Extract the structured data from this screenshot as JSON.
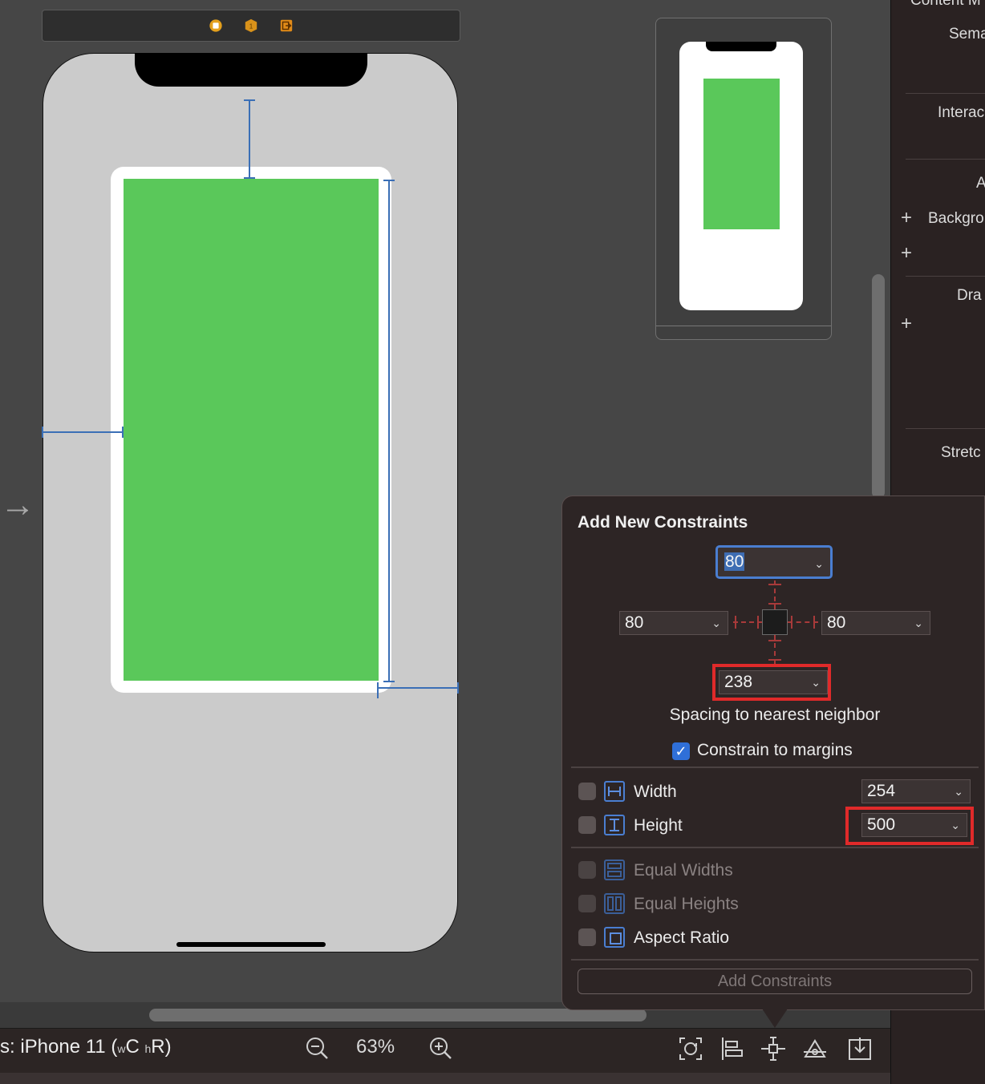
{
  "canvas": {
    "scene_icons": [
      "view-controller-icon",
      "first-responder-icon",
      "exit-icon"
    ],
    "entry_arrow": "→"
  },
  "inspector": {
    "labels": [
      "Content M",
      "Sema",
      "Interac",
      "A",
      "Backgro",
      "Dra",
      "Stretc"
    ]
  },
  "popover": {
    "title": "Add New Constraints",
    "top_value": "80",
    "left_value": "80",
    "right_value": "80",
    "bottom_value": "238",
    "spacing_label": "Spacing to nearest neighbor",
    "constrain_margins_label": "Constrain to margins",
    "constrain_margins_checked": true,
    "width_label": "Width",
    "width_value": "254",
    "height_label": "Height",
    "height_value": "500",
    "equal_widths_label": "Equal Widths",
    "equal_heights_label": "Equal Heights",
    "aspect_ratio_label": "Aspect Ratio",
    "add_button_label": "Add Constraints"
  },
  "bottom_bar": {
    "device_prefix": "s: iPhone 11 (",
    "w_small": "w",
    "w_class": "C",
    "h_small": "h",
    "h_class": "R",
    "device_suffix": ")",
    "zoom_level": "63%"
  },
  "colors": {
    "green_view": "#5ac85a",
    "constraint_blue": "#3b6fb6",
    "highlight_red": "#e02a2a",
    "accent_blue": "#2f6fd8"
  }
}
